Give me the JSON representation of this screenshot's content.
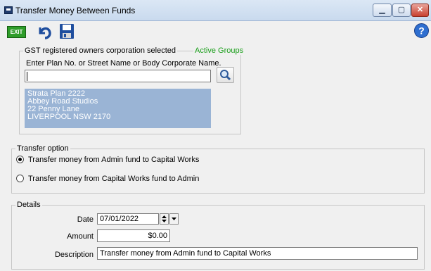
{
  "window": {
    "title": "Transfer Money Between Funds",
    "min_label": "▁",
    "max_label": "▢",
    "close_label": "✕"
  },
  "toolbar": {
    "exit_label": "EXIT"
  },
  "owners_group": {
    "legend": "GST registered owners corporation selected",
    "link": "Active Groups",
    "prompt": "Enter Plan No. or Street Name or Body Corporate Name.",
    "search_value": "",
    "address_lines": [
      "Strata Plan 2222",
      "Abbey Road Studios",
      "22 Penny Lane",
      "LIVERPOOL  NSW  2170"
    ]
  },
  "transfer_option": {
    "legend": "Transfer option",
    "options": [
      {
        "label": "Transfer money from Admin fund to Capital Works",
        "checked": true
      },
      {
        "label": "Transfer money from Capital Works fund to Admin",
        "checked": false
      }
    ]
  },
  "details": {
    "legend": "Details",
    "date_label": "Date",
    "date_value": "07/01/2022",
    "amount_label": "Amount",
    "amount_value": "$0.00",
    "description_label": "Description",
    "description_value": "Transfer money from Admin fund to Capital Works"
  },
  "colors": {
    "active_groups_link": "#1a9e1a",
    "address_background": "#9ab4d5",
    "exit_button": "#2f9d2a"
  }
}
